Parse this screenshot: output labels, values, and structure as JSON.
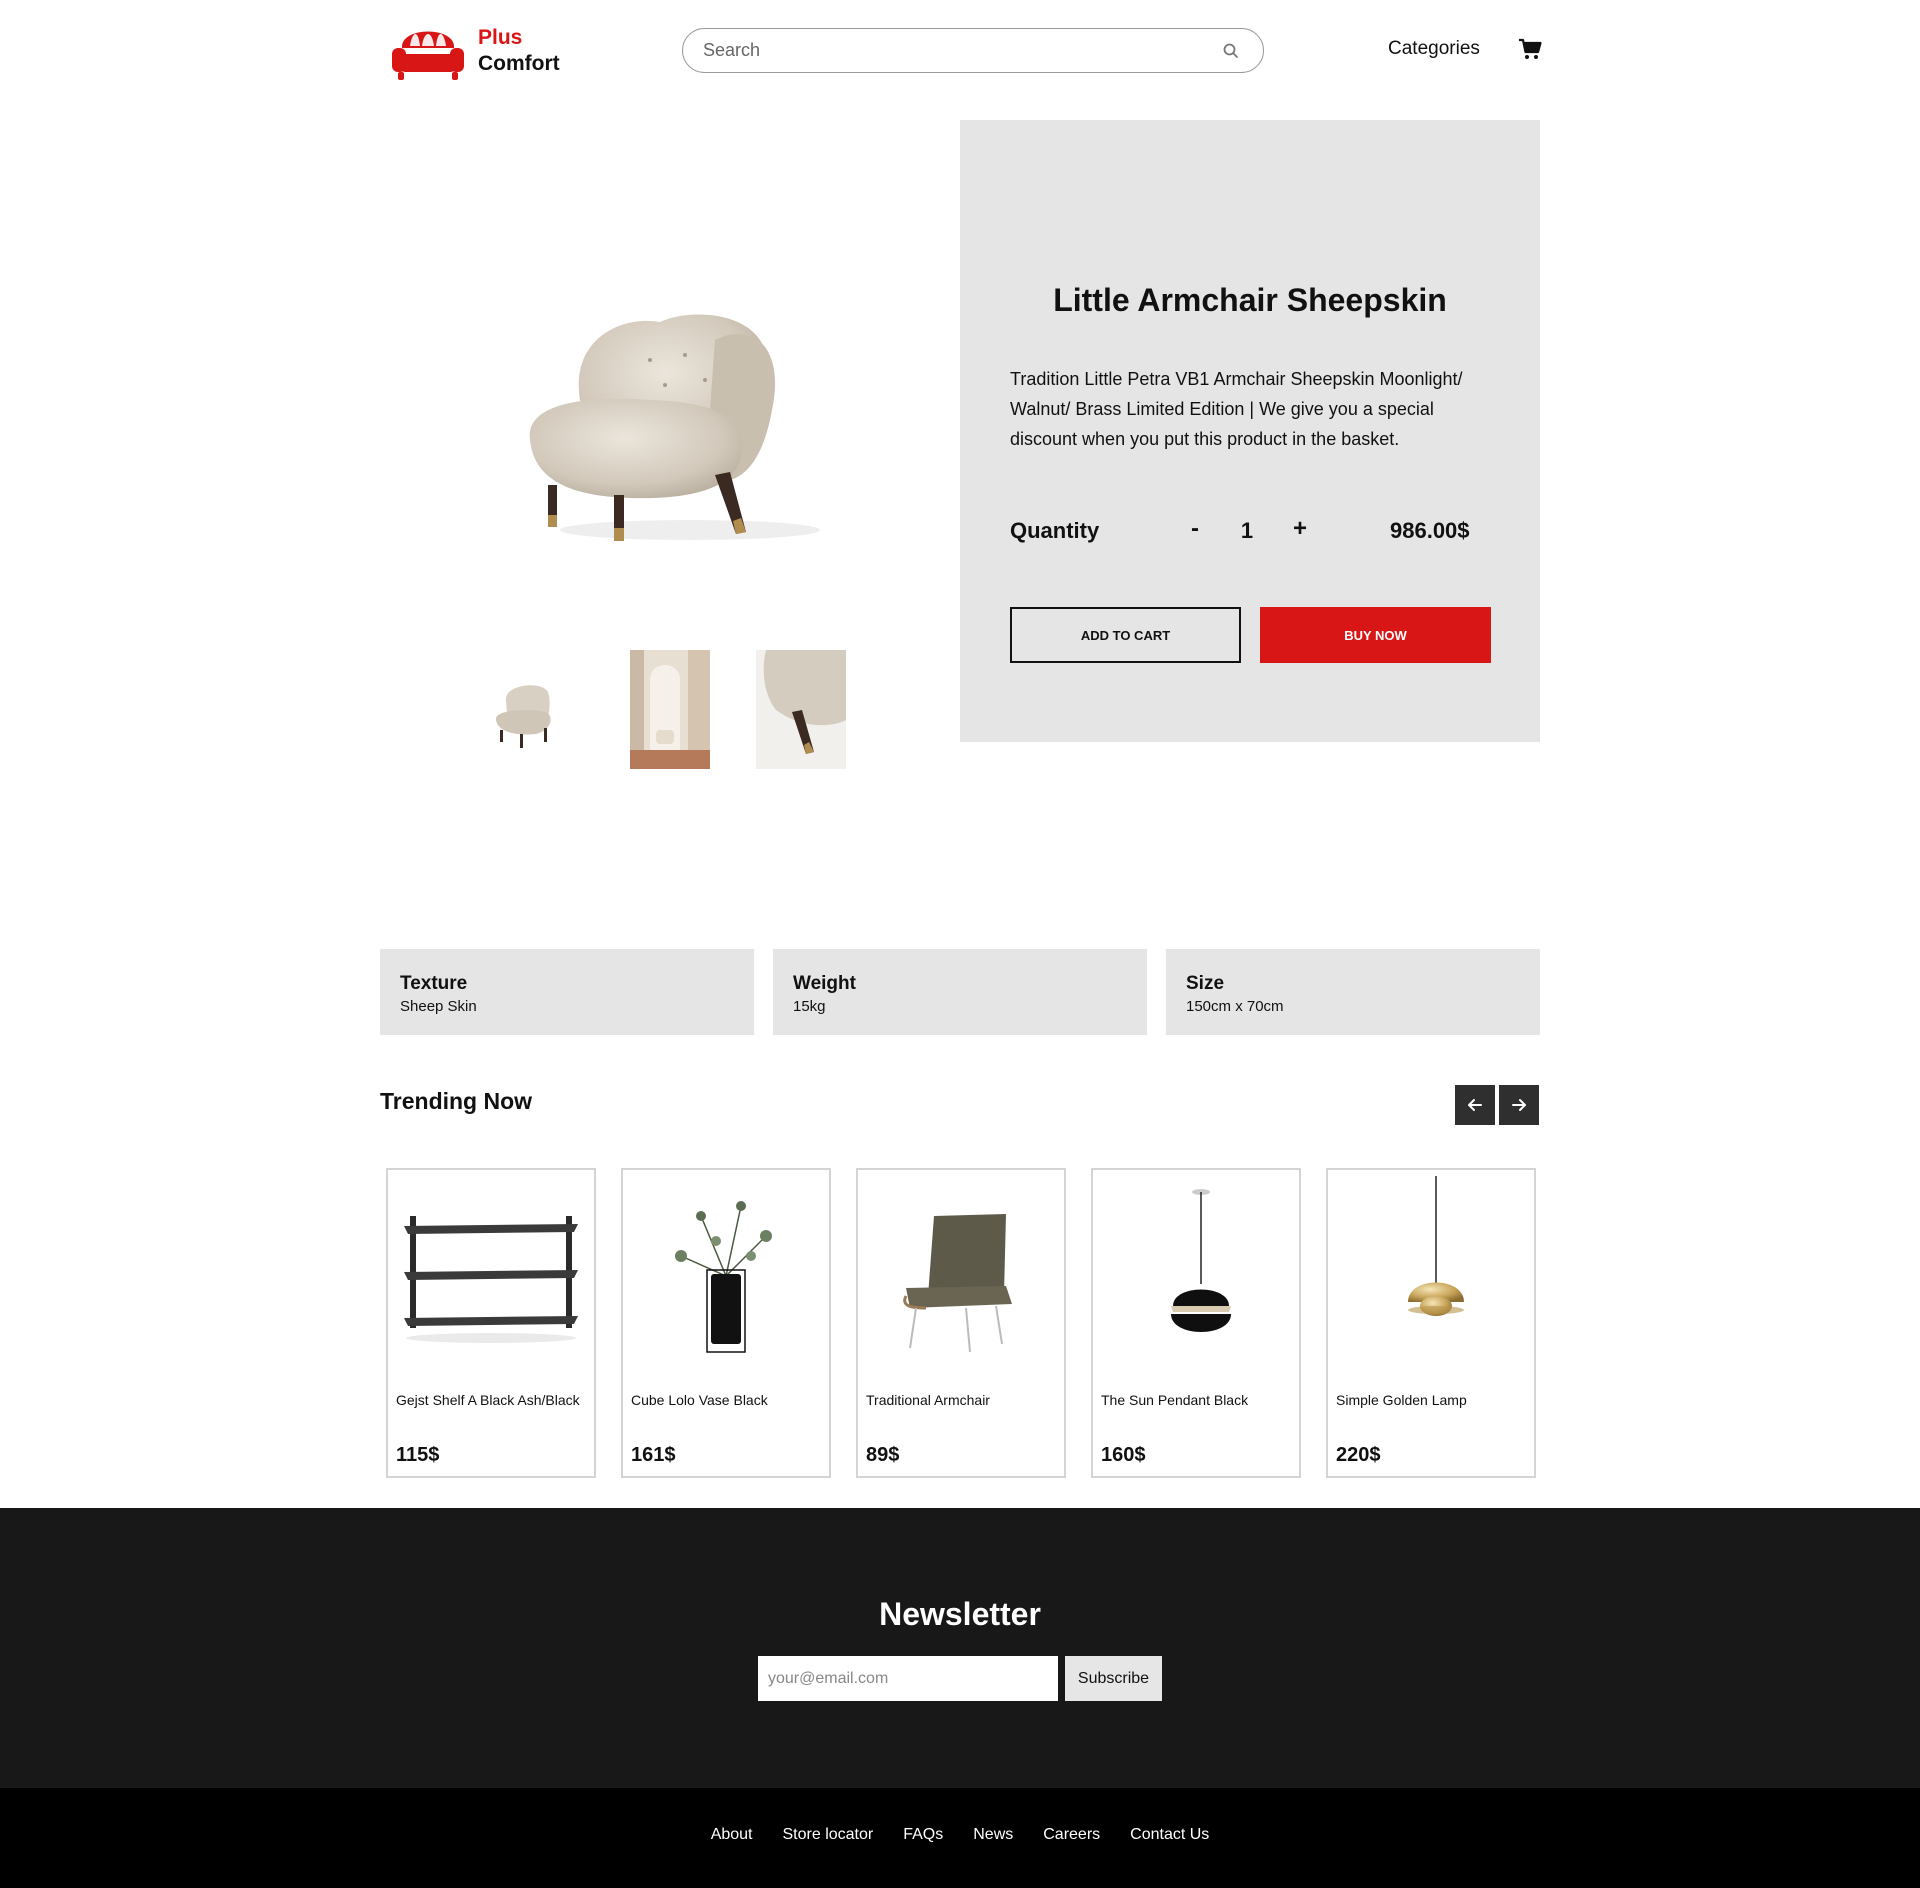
{
  "brand": {
    "line1": "Plus",
    "line2": "Comfort",
    "accent": "#d91616"
  },
  "header": {
    "search_placeholder": "Search",
    "categories_label": "Categories",
    "cart_icon": "cart-icon",
    "search_icon": "search-icon"
  },
  "product": {
    "title": "Little Armchair Sheepskin",
    "description": "Tradition Little Petra VB1 Armchair Sheepskin Moonlight/ Walnut/ Brass Limited Edition | We give you a special discount when you put this product in the basket.",
    "quantity_label": "Quantity",
    "qty_minus": "-",
    "qty_value": "1",
    "qty_plus": "+",
    "price": "986.00$",
    "add_to_cart": "ADD TO CART",
    "buy_now": "BUY NOW"
  },
  "specs": [
    {
      "title": "Texture",
      "value": "Sheep Skin"
    },
    {
      "title": "Weight",
      "value": "15kg"
    },
    {
      "title": "Size",
      "value": "150cm x 70cm"
    }
  ],
  "trending": {
    "title": "Trending Now",
    "items": [
      {
        "name": "Gejst Shelf A Black Ash/Black",
        "price": "115$"
      },
      {
        "name": "Cube Lolo Vase Black",
        "price": "161$"
      },
      {
        "name": "Traditional Armchair",
        "price": "89$"
      },
      {
        "name": "The Sun Pendant Black",
        "price": "160$"
      },
      {
        "name": "Simple Golden Lamp",
        "price": "220$"
      }
    ]
  },
  "newsletter": {
    "title": "Newsletter",
    "placeholder": "your@email.com",
    "button": "Subscribe"
  },
  "footer": {
    "links": [
      "About",
      "Store locator",
      "FAQs",
      "News",
      "Careers",
      "Contact Us"
    ]
  }
}
